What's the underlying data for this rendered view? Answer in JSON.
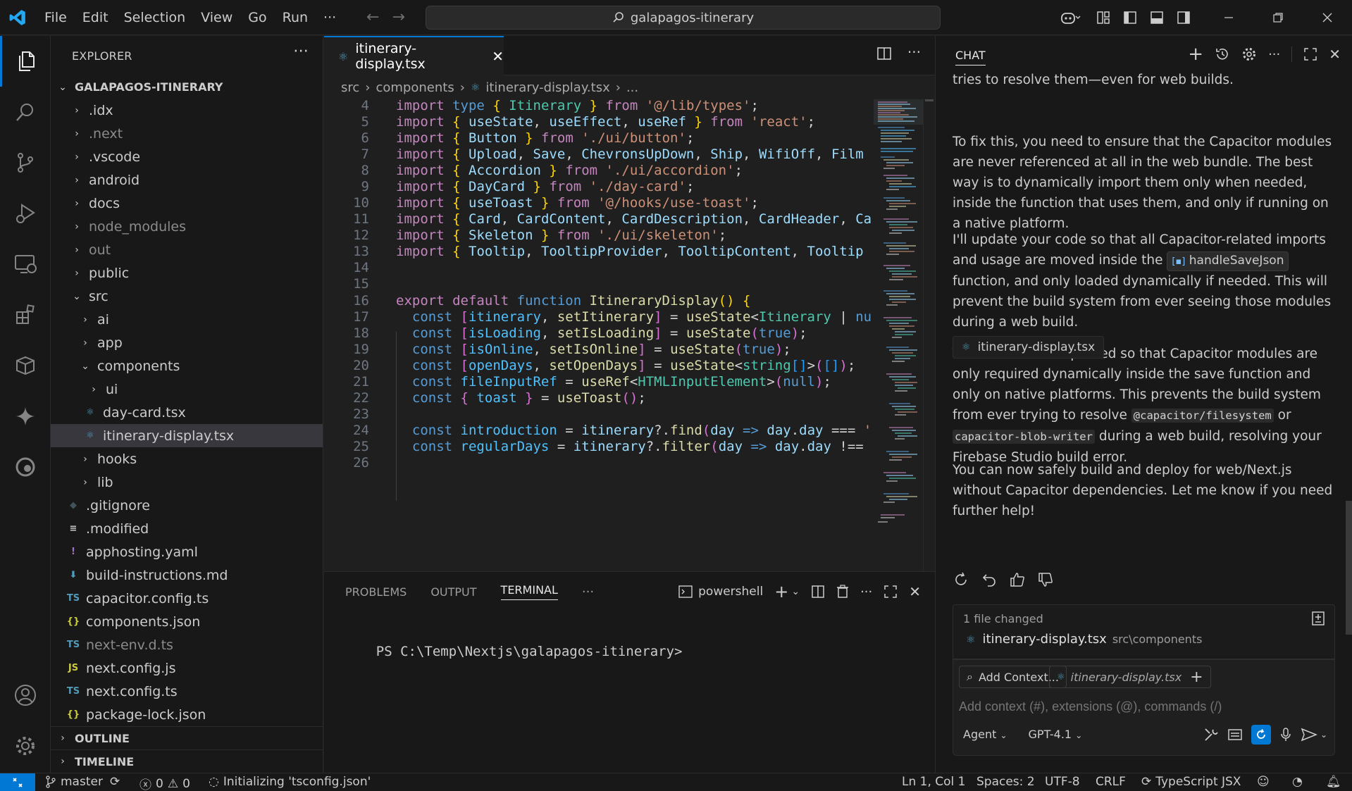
{
  "titlebar": {
    "menu": [
      "File",
      "Edit",
      "Selection",
      "View",
      "Go",
      "Run",
      "···"
    ],
    "search_text": "galapagos-itinerary"
  },
  "activity_bar": [
    "explorer-icon",
    "search-icon",
    "source-control-icon",
    "run-debug-icon",
    "remote-explorer-icon",
    "extensions-icon",
    "containers-icon",
    "gemini-icon",
    "edge-icon",
    "account-icon",
    "settings-gear-icon"
  ],
  "sidebar": {
    "title": "EXPLORER",
    "root": "GALAPAGOS-ITINERARY",
    "items": [
      {
        "label": ".idx"
      },
      {
        "label": ".next"
      },
      {
        "label": ".vscode"
      },
      {
        "label": "android"
      },
      {
        "label": "docs"
      },
      {
        "label": "node_modules"
      },
      {
        "label": "out"
      },
      {
        "label": "public"
      },
      {
        "label": "src"
      },
      {
        "label": "ai"
      },
      {
        "label": "app"
      },
      {
        "label": "components"
      },
      {
        "label": "ui"
      },
      {
        "label": "day-card.tsx"
      },
      {
        "label": "itinerary-display.tsx"
      },
      {
        "label": "hooks"
      },
      {
        "label": "lib"
      },
      {
        "label": ".gitignore"
      },
      {
        "label": ".modified"
      },
      {
        "label": "apphosting.yaml"
      },
      {
        "label": "build-instructions.md"
      },
      {
        "label": "capacitor.config.ts"
      },
      {
        "label": "components.json"
      },
      {
        "label": "next-env.d.ts"
      },
      {
        "label": "next.config.js"
      },
      {
        "label": "next.config.ts"
      },
      {
        "label": "package-lock.json"
      }
    ],
    "outline": "OUTLINE",
    "timeline": "TIMELINE"
  },
  "editor": {
    "tab": "itinerary-display.tsx",
    "breadcrumb": [
      "src",
      "components",
      "itinerary-display.tsx",
      "..."
    ],
    "line_numbers": [
      "4",
      "5",
      "6",
      "7",
      "8",
      "9",
      "10",
      "11",
      "12",
      "13",
      "14",
      "15",
      "16",
      "17",
      "18",
      "19",
      "20",
      "21",
      "22",
      "23",
      "24",
      "25",
      "26"
    ]
  },
  "panel": {
    "tabs": [
      "PROBLEMS",
      "OUTPUT",
      "TERMINAL",
      "···"
    ],
    "shell": "powershell",
    "prompt": "PS C:\\Temp\\Nextjs\\galapagos-itinerary>"
  },
  "chat": {
    "title": "CHAT",
    "p0": "tries to resolve them—even for web builds.",
    "p1": "To fix this, you need to ensure that the Capacitor modules are never referenced at all in the web bundle. The best way is to dynamically import them only when needed, inside the function that uses them, and only if running on a native platform.",
    "p2a": "I'll update your code so that all Capacitor-related imports and usage are moved inside the",
    "p2_chip": "handleSaveJson",
    "p2b": "function, and only loaded dynamically if needed. This will prevent the build system from ever seeing those modules during a web build.",
    "file_pill": "itinerary-display.tsx",
    "p3a": "The code is now updated so that Capacitor modules are only required dynamically inside the save function and only on native platforms. This prevents the build system from ever trying to resolve",
    "p3_code1": "@capacitor/filesystem",
    "p3_or": "or",
    "p3_code2": "capacitor-blob-writer",
    "p3b": "during a web build, resolving your Firebase Studio build error.",
    "p4": "You can now safely build and deploy for web/Next.js without Capacitor dependencies. Let me know if you need further help!",
    "files_changed": "1 file changed",
    "changed_file": "itinerary-display.tsx",
    "changed_path": "src\\components",
    "add_context": "Add Context...",
    "context_file": "itinerary-display.tsx",
    "placeholder": "Add context (#), extensions (@), commands (/)",
    "mode": "Agent",
    "model": "GPT-4.1"
  },
  "status": {
    "branch": "master",
    "errors": "0",
    "warnings": "0",
    "initializing": "Initializing 'tsconfig.json'",
    "position": "Ln 1, Col 1",
    "spaces": "Spaces: 2",
    "encoding": "UTF-8",
    "eol": "CRLF",
    "language": "TypeScript JSX"
  },
  "colors": {
    "accent": "#0078d4",
    "background": "#1f1f1f",
    "sidebar": "#181818"
  }
}
